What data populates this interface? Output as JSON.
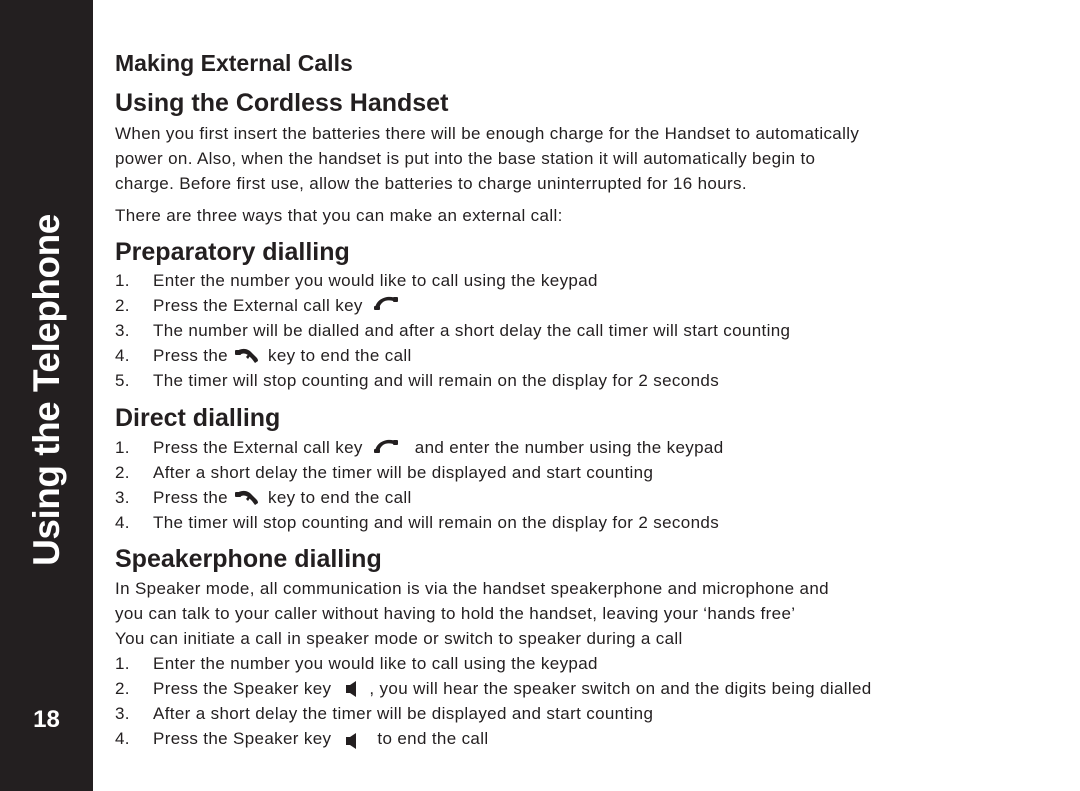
{
  "sidebar": {
    "section_title": "Using the Telephone",
    "page_number": "18"
  },
  "main": {
    "title": "Making External Calls",
    "subtitle": "Using the Cordless Handset",
    "intro": [
      "When you first insert the batteries there will be enough charge for the Handset to automatically",
      "power on.  Also, when the handset is put into the base station it will automatically begin to",
      "charge. Before first use, allow the batteries to charge uninterrupted for 16 hours."
    ],
    "ways_text": "There are three ways that you can make an external call:",
    "sections": [
      {
        "heading": "Preparatory dialling",
        "steps": [
          {
            "num": "1.",
            "text": "Enter the number you would like to call using the keypad"
          },
          {
            "num": "2.",
            "before": "Press the External call key",
            "icon": "external-call-key-icon",
            "after": ""
          },
          {
            "num": "3.",
            "text": "The number will be dialled and after a short delay the call timer will start counting"
          },
          {
            "num": "4.",
            "before": "Press the",
            "icon": "end-call-key-icon",
            "after": "key to end the call"
          },
          {
            "num": "5.",
            "text": "The timer will stop counting and will remain on the display for 2 seconds"
          }
        ]
      },
      {
        "heading": "Direct dialling",
        "steps": [
          {
            "num": "1.",
            "before": "Press the External call key",
            "icon": "external-call-key-icon",
            "after": "and enter the number using the keypad"
          },
          {
            "num": "2.",
            "text": "After a short delay the timer will be displayed and start counting"
          },
          {
            "num": "3.",
            "before": "Press the",
            "icon": "end-call-key-icon",
            "after": "key to end the call"
          },
          {
            "num": "4.",
            "text": "The timer will stop counting and will remain on the display for 2 seconds"
          }
        ]
      },
      {
        "heading": "Speakerphone dialling",
        "intro": [
          "In Speaker mode, all communication is via the handset speakerphone and microphone and",
          "you can talk to your caller without having to hold the handset, leaving your ‘hands free’",
          "You can initiate a call in speaker mode or switch to speaker during a call"
        ],
        "steps": [
          {
            "num": "1.",
            "text": "Enter the number you would like to call using the keypad"
          },
          {
            "num": "2.",
            "before": "Press the Speaker key",
            "icon": "speaker-key-icon",
            "after": ", you will hear the speaker switch on and the digits being dialled"
          },
          {
            "num": "3.",
            "text": "After a short delay the timer will be displayed and start counting"
          },
          {
            "num": "4.",
            "before": "Press the Speaker key",
            "icon": "speaker-key-icon",
            "after": "to end the call"
          }
        ]
      }
    ]
  }
}
